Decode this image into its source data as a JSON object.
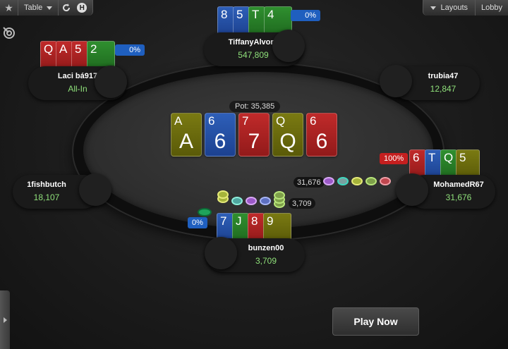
{
  "toolbar": {
    "table_label": "Table",
    "help_letter": "H",
    "layouts_label": "Layouts",
    "lobby_label": "Lobby"
  },
  "pot": {
    "label": "Pot:",
    "value": "35,385"
  },
  "board": [
    {
      "rank": "A",
      "suit": "spades"
    },
    {
      "rank": "6",
      "suit": "diamonds"
    },
    {
      "rank": "7",
      "suit": "hearts"
    },
    {
      "rank": "Q",
      "suit": "spades"
    },
    {
      "rank": "6",
      "suit": "hearts"
    }
  ],
  "players": {
    "tiffany": {
      "name": "TiffanyAlvord",
      "stack": "547,809",
      "equity": "0%",
      "cards": [
        {
          "rank": "8",
          "suit": "diamonds"
        },
        {
          "rank": "5",
          "suit": "diamonds"
        },
        {
          "rank": "T",
          "suit": "clubs"
        },
        {
          "rank": "4",
          "suit": "clubs"
        }
      ]
    },
    "laci": {
      "name": "Laci bá917",
      "stack": "All-In",
      "equity": "0%",
      "cards": [
        {
          "rank": "Q",
          "suit": "hearts"
        },
        {
          "rank": "A",
          "suit": "hearts"
        },
        {
          "rank": "5",
          "suit": "hearts"
        },
        {
          "rank": "2",
          "suit": "clubs"
        }
      ]
    },
    "trubia": {
      "name": "trubia47",
      "stack": "12,847"
    },
    "fishbutch": {
      "name": "1fishbutch",
      "stack": "18,107"
    },
    "mohamed": {
      "name": "MohamedR67",
      "stack": "31,676",
      "equity": "100%",
      "bet": "31,676",
      "cards": [
        {
          "rank": "6",
          "suit": "hearts"
        },
        {
          "rank": "T",
          "suit": "diamonds"
        },
        {
          "rank": "Q",
          "suit": "clubs"
        },
        {
          "rank": "5",
          "suit": "spades"
        }
      ]
    },
    "bunzen": {
      "name": "bunzen00",
      "stack": "3,709",
      "equity": "0%",
      "bet": "3,709",
      "cards": [
        {
          "rank": "7",
          "suit": "diamonds"
        },
        {
          "rank": "J",
          "suit": "clubs"
        },
        {
          "rank": "8",
          "suit": "hearts"
        },
        {
          "rank": "9",
          "suit": "spades"
        }
      ]
    }
  },
  "play_now_label": "Play Now",
  "colors": {
    "spades": "#5d5d0c",
    "diamonds": "#2553a8",
    "hearts": "#a82222",
    "clubs": "#257d25",
    "stack_green": "#8fe07a"
  }
}
